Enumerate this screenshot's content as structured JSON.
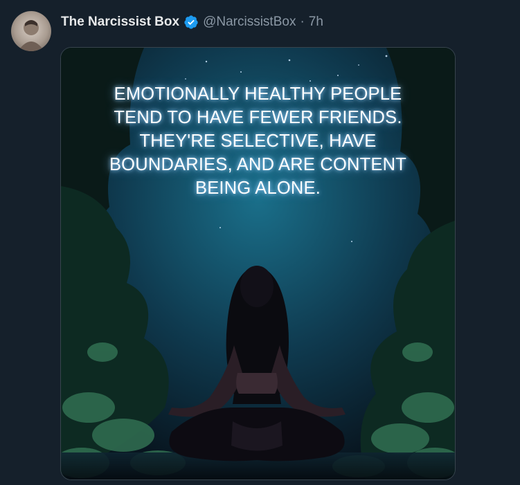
{
  "tweet": {
    "author_name": "The Narcissist Box",
    "handle": "@NarcissistBox",
    "separator": "·",
    "time": "7h",
    "verified_color": "#1d9bf0",
    "avatar_icon": "profile-avatar"
  },
  "image": {
    "quote_lines": [
      "EMOTIONALLY HEALTHY PEOPLE",
      "TEND TO HAVE FEWER FRIENDS.",
      "THEY'RE SELECTIVE, HAVE",
      "BOUNDARIES, AND ARE CONTENT",
      "BEING ALONE."
    ],
    "sky_color": "#0f3a4f",
    "foliage_color": "#1c4a3a"
  }
}
